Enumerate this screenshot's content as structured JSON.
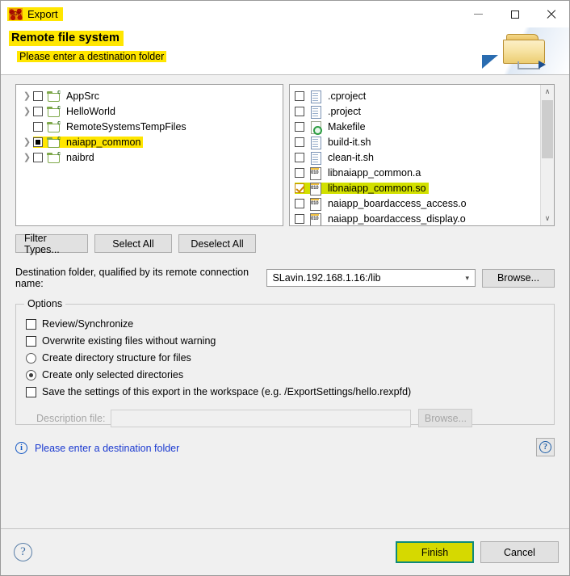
{
  "window": {
    "title": "Export",
    "app_icon": "sdk-icon",
    "minimize_label": "—",
    "maximize_label": "☐",
    "close_label": "✕"
  },
  "banner": {
    "title": "Remote file system",
    "subtitle": "Please enter a destination folder",
    "icon": "export-folder-icon",
    "highlight_color": "#ffe600"
  },
  "tree": {
    "items": [
      {
        "label": "AppSrc",
        "icon": "c-project-folder-icon",
        "expandable": true,
        "check": "unchecked",
        "highlight": false
      },
      {
        "label": "HelloWorld",
        "icon": "c-project-folder-icon",
        "expandable": true,
        "check": "unchecked",
        "highlight": false
      },
      {
        "label": "RemoteSystemsTempFiles",
        "icon": "c-project-folder-icon",
        "expandable": false,
        "check": "unchecked",
        "highlight": false
      },
      {
        "label": "naiapp_common",
        "icon": "c-project-folder-icon",
        "expandable": true,
        "check": "partial",
        "highlight": true
      },
      {
        "label": "naibrd",
        "icon": "c-project-folder-icon",
        "expandable": true,
        "check": "unchecked",
        "highlight": false
      }
    ]
  },
  "files": {
    "items": [
      {
        "label": ".cproject",
        "icon": "text-file-icon",
        "check": "unchecked",
        "highlight": false
      },
      {
        "label": ".project",
        "icon": "text-file-icon",
        "check": "unchecked",
        "highlight": false
      },
      {
        "label": "Makefile",
        "icon": "makefile-icon",
        "check": "unchecked",
        "highlight": false
      },
      {
        "label": "build-it.sh",
        "icon": "text-file-icon",
        "check": "unchecked",
        "highlight": false
      },
      {
        "label": "clean-it.sh",
        "icon": "text-file-icon",
        "check": "unchecked",
        "highlight": false
      },
      {
        "label": "libnaiapp_common.a",
        "icon": "binary-file-icon",
        "check": "unchecked",
        "highlight": false
      },
      {
        "label": "libnaiapp_common.so",
        "icon": "binary-file-icon",
        "check": "checked",
        "highlight": true
      },
      {
        "label": "naiapp_boardaccess_access.o",
        "icon": "binary-file-icon",
        "check": "unchecked",
        "highlight": false
      },
      {
        "label": "naiapp_boardaccess_display.o",
        "icon": "binary-file-icon",
        "check": "unchecked",
        "highlight": false
      }
    ],
    "scrollbar": {
      "up_arrow": "∧",
      "down_arrow": "∨"
    },
    "highlight_color": "#d2e000"
  },
  "selection_buttons": {
    "filter_types": "Filter Types...",
    "select_all": "Select All",
    "deselect_all": "Deselect All"
  },
  "destination": {
    "label": "Destination folder, qualified by its remote connection name:",
    "value": "SLavin.192.168.1.16:/lib",
    "dropdown_icon": "chevron-down-icon",
    "browse": "Browse..."
  },
  "options": {
    "legend": "Options",
    "items": [
      {
        "type": "checkbox",
        "label": "Review/Synchronize",
        "checked": false
      },
      {
        "type": "checkbox",
        "label": "Overwrite existing files without warning",
        "checked": false
      },
      {
        "type": "radio",
        "label": "Create directory structure for files",
        "selected": false
      },
      {
        "type": "radio",
        "label": "Create only selected directories",
        "selected": true
      },
      {
        "type": "checkbox",
        "label": "Save the settings of this export in the workspace (e.g. /ExportSettings/hello.rexpfd)",
        "checked": false
      }
    ],
    "description_label": "Description file:",
    "description_value": "",
    "description_browse": "Browse..."
  },
  "status": {
    "icon": "info-icon",
    "text": "Please enter a destination folder",
    "help_icon": "help-icon",
    "help_glyph": "?"
  },
  "footer": {
    "help_glyph": "?",
    "finish": "Finish",
    "cancel": "Cancel",
    "finish_bg": "#d6d900",
    "finish_border": "#0e8a7a"
  }
}
